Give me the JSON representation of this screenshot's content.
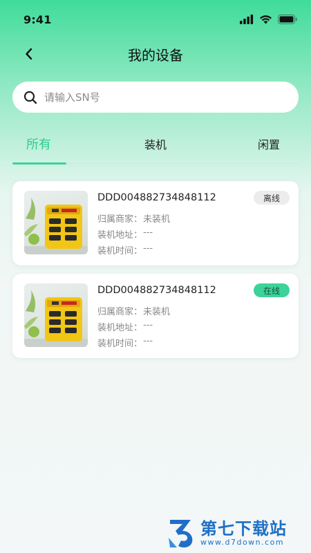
{
  "status_bar": {
    "time": "9:41"
  },
  "header": {
    "title": "我的设备"
  },
  "search": {
    "placeholder": "请输入SN号",
    "value": ""
  },
  "tabs": [
    {
      "label": "所有",
      "active": true
    },
    {
      "label": "装机",
      "active": false
    },
    {
      "label": "闲置",
      "active": false
    }
  ],
  "devices": [
    {
      "sn": "DDD004882734848112",
      "status": "离线",
      "merchant_label": "归属商家：",
      "merchant": "未装机",
      "address_label": "装机地址：",
      "address": "---",
      "time_label": "装机时间：",
      "time": "---"
    },
    {
      "sn": "DDD004882734848112",
      "status": "在线",
      "merchant_label": "归属商家：",
      "merchant": "未装机",
      "address_label": "装机地址：",
      "address": "---",
      "time_label": "装机时间：",
      "time": "---"
    }
  ],
  "watermark": {
    "title": "第七下载站",
    "url": "www.d7down.com"
  },
  "colors": {
    "accent": "#3cd39a",
    "online": "#3bd39a",
    "offline": "#ececec",
    "watermark": "#1f6fc6"
  },
  "icons": [
    "signal-icon",
    "wifi-icon",
    "battery-icon",
    "back-arrow-icon",
    "search-icon",
    "device-image",
    "watermark-logo-icon"
  ]
}
